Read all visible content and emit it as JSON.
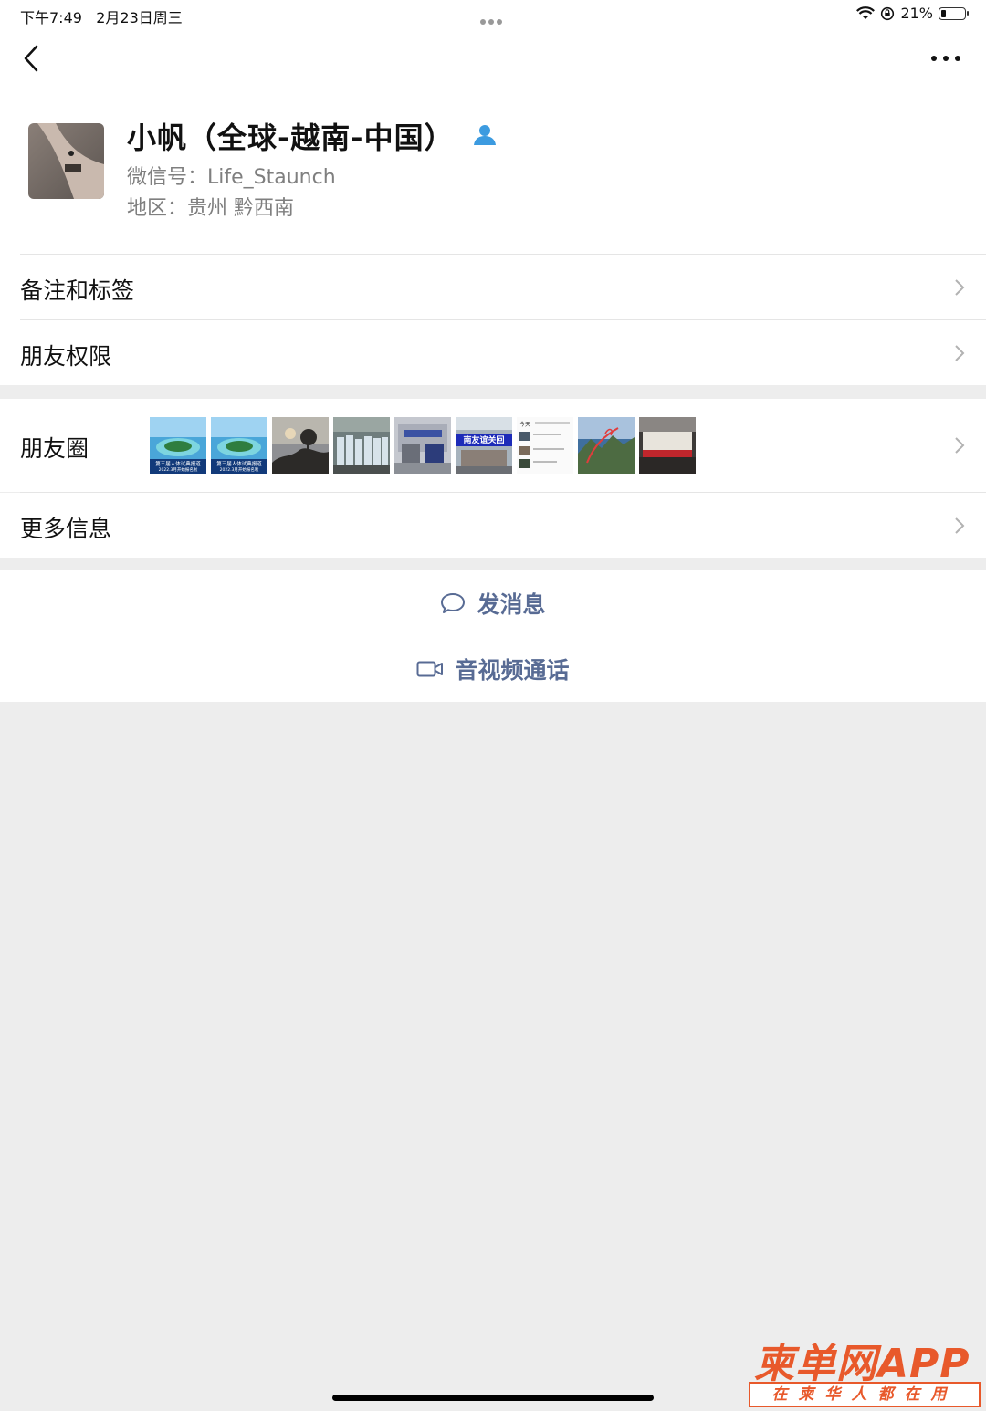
{
  "status_bar": {
    "time": "下午7:49",
    "date": "2月23日周三",
    "battery_percent": "21%",
    "battery_level": 0.21
  },
  "profile": {
    "name": "小帆（全球-越南-中国）",
    "wechat_id": "微信号：Life_Staunch",
    "region": "地区：贵州 黔西南"
  },
  "rows": {
    "remarks_label": "备注和标签",
    "permissions_label": "朋友权限",
    "moments_label": "朋友圈",
    "more_info_label": "更多信息"
  },
  "moments_thumbnails": [
    {
      "caption": "第三届人体试典报道",
      "sub": "2022.3月开始报名啦"
    },
    {
      "caption": "第三届人体试典报道",
      "sub": "2022.3月开始报名啦"
    },
    {
      "caption": ""
    },
    {
      "caption": ""
    },
    {
      "caption": ""
    },
    {
      "caption": "南友谊关回"
    },
    {
      "caption": "今天"
    },
    {
      "caption": ""
    },
    {
      "caption": ""
    }
  ],
  "actions": {
    "message_label": "发消息",
    "call_label": "音视频通话"
  },
  "watermark": {
    "main": "柬单网APP",
    "sub": "在柬华人都在用"
  },
  "colors": {
    "link_blue": "#586b94",
    "background": "#ededed",
    "watermark": "#e8592b"
  }
}
